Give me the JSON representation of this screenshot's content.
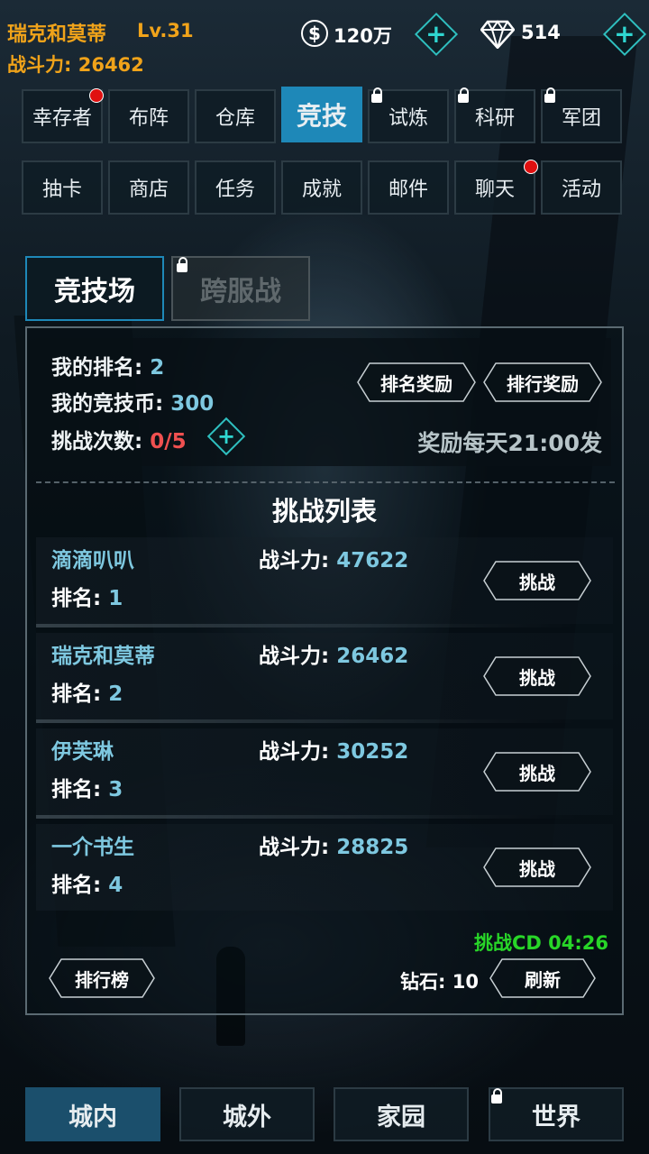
{
  "header": {
    "player_name": "瑞克和莫蒂",
    "level": "Lv.31",
    "power_label": "战斗力: ",
    "power_value": "26462",
    "coin_symbol": "$",
    "coins": "120万",
    "gems": "514",
    "plus": "+"
  },
  "top_tabs": [
    "幸存者",
    "布阵",
    "仓库",
    "竞技",
    "试炼",
    "科研",
    "军团"
  ],
  "second_tabs": [
    "抽卡",
    "商店",
    "任务",
    "成就",
    "邮件",
    "聊天",
    "活动"
  ],
  "arena_tabs": {
    "active": "竞技场",
    "locked": "跨服战"
  },
  "info": {
    "rank_label": "我的排名: ",
    "rank_value": "2",
    "coin_label": "我的竞技币: ",
    "coin_value": "300",
    "attempts_label": "挑战次数: ",
    "attempts_value": "0/5",
    "rank_reward_btn": "排名奖励",
    "leaderboard_reward_btn": "排行奖励",
    "reward_note": "奖励每天21:00发"
  },
  "list_title": "挑战列表",
  "opponents": [
    {
      "name": "滴滴叭叭",
      "rank_label": "排名: ",
      "rank": "1",
      "power_label": "战斗力: ",
      "power": "47622",
      "btn": "挑战"
    },
    {
      "name": "瑞克和莫蒂",
      "rank_label": "排名: ",
      "rank": "2",
      "power_label": "战斗力: ",
      "power": "26462",
      "btn": "挑战"
    },
    {
      "name": "伊芙琳",
      "rank_label": "排名: ",
      "rank": "3",
      "power_label": "战斗力: ",
      "power": "30252",
      "btn": "挑战"
    },
    {
      "name": "一介书生",
      "rank_label": "排名: ",
      "rank": "4",
      "power_label": "战斗力: ",
      "power": "28825",
      "btn": "挑战"
    }
  ],
  "footer": {
    "cd": "挑战CD 04:26",
    "leaderboard_btn": "排行榜",
    "diamonds": "钻石: 10",
    "refresh_btn": "刷新"
  },
  "bottom_nav": [
    "城内",
    "城外",
    "家园",
    "世界"
  ],
  "colors": {
    "accent": "#1e88b8",
    "gold": "#f0a31a",
    "cyan": "#7ec8e0",
    "red": "#f05050",
    "green": "#28d628"
  }
}
